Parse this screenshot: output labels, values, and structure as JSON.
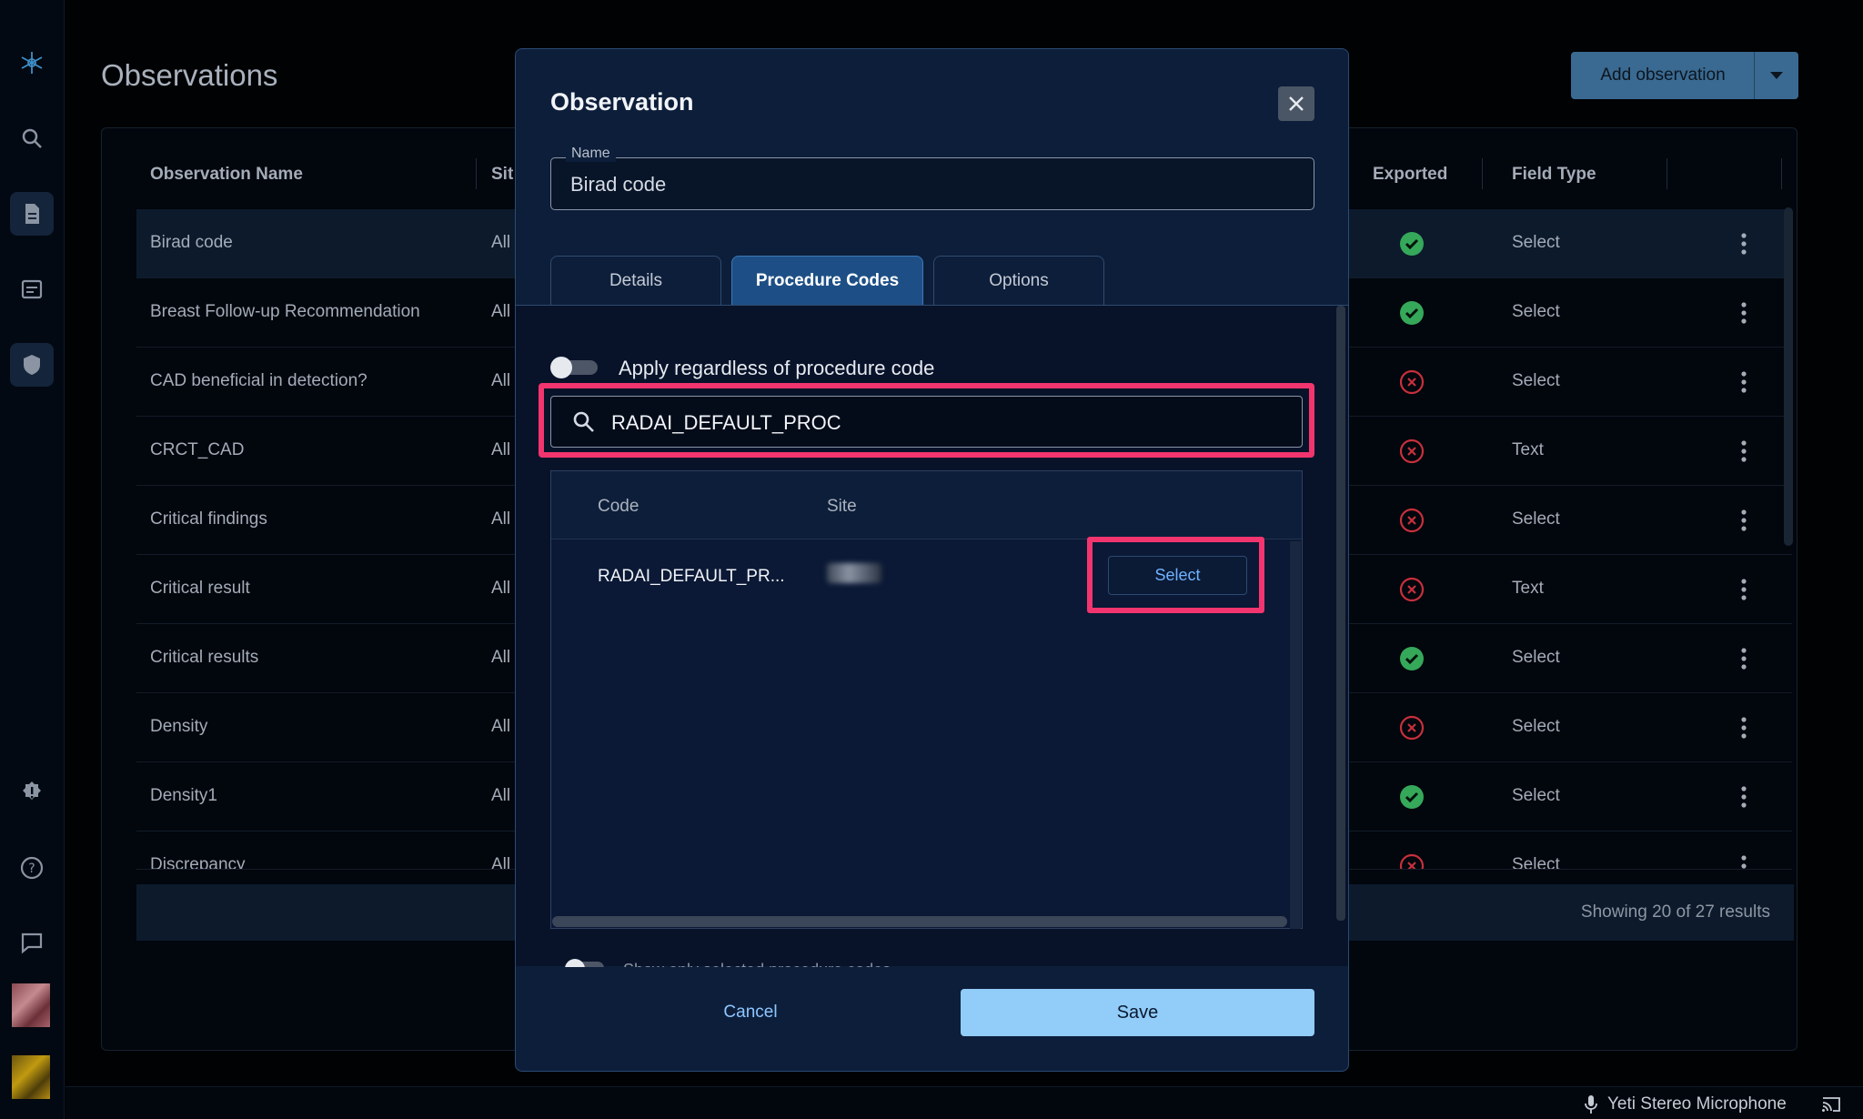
{
  "page": {
    "title": "Observations",
    "add_button": "Add observation",
    "columns": [
      "Observation Name",
      "Sit",
      "Exported",
      "Field Type"
    ],
    "rows": [
      {
        "name": "Birad code",
        "site": "All",
        "exported": true,
        "field_type": "Select"
      },
      {
        "name": "Breast Follow-up Recommendation",
        "site": "All",
        "exported": true,
        "field_type": "Select"
      },
      {
        "name": "CAD beneficial in detection?",
        "site": "All",
        "exported": false,
        "field_type": "Select"
      },
      {
        "name": "CRCT_CAD",
        "site": "All",
        "exported": false,
        "field_type": "Text"
      },
      {
        "name": "Critical findings",
        "site": "All",
        "exported": false,
        "field_type": "Select"
      },
      {
        "name": "Critical result",
        "site": "All",
        "exported": false,
        "field_type": "Text"
      },
      {
        "name": "Critical results",
        "site": "All",
        "exported": true,
        "field_type": "Select"
      },
      {
        "name": "Density",
        "site": "All",
        "exported": false,
        "field_type": "Select"
      },
      {
        "name": "Density1",
        "site": "All",
        "exported": true,
        "field_type": "Select"
      },
      {
        "name": "Discrepancy",
        "site": "All",
        "exported": false,
        "field_type": "Select"
      }
    ],
    "footer": "Showing 20 of 27 results"
  },
  "modal": {
    "title": "Observation",
    "name_label": "Name",
    "name_value": "Birad code",
    "tabs": [
      "Details",
      "Procedure Codes",
      "Options"
    ],
    "active_tab": "Procedure Codes",
    "toggle_label": "Apply regardless of procedure code",
    "search_value": "RADAI_DEFAULT_PROC",
    "grid_columns": {
      "code": "Code",
      "site": "Site"
    },
    "grid_row": {
      "code": "RADAI_DEFAULT_PR...",
      "select": "Select"
    },
    "peek_text": "Show only selected procedure codes",
    "cancel": "Cancel",
    "save": "Save"
  },
  "status_bar": {
    "mic": "Yeti Stereo Microphone"
  },
  "colors": {
    "accent": "#1d4f86",
    "highlight": "#f2356f",
    "save": "#92ccf9",
    "ok": "#35a85a",
    "error": "#c8303c"
  }
}
